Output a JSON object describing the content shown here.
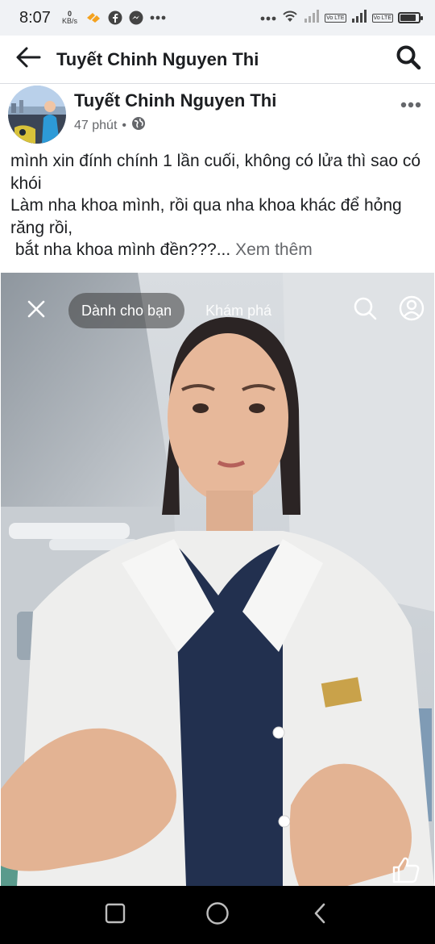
{
  "status_bar": {
    "time": "8:07",
    "net_speed_value": "0",
    "net_speed_unit": "KB/s",
    "lte_label_1": "Vo LTE",
    "lte_label_2": "Vo LTE",
    "battery_level": 0.85,
    "icons": [
      "mail-heart-icon",
      "facebook-icon",
      "messenger-icon",
      "more-dots-icon",
      "wifi-icon",
      "signal-icon",
      "battery-icon"
    ]
  },
  "header": {
    "title": "Tuyết Chinh Nguyen Thi"
  },
  "post": {
    "author": "Tuyết Chinh Nguyen Thi",
    "time_ago": "47 phút",
    "separator": "•",
    "audience_icon": "globe-icon",
    "text_lines": [
      "mình xin đính chính 1 lần cuối, không có lửa thì sao có khói",
      "Làm nha khoa mình, rồi qua nha khoa khác để hỏng răng rồi,",
      " bắt nha khoa mình đền???..."
    ],
    "see_more": "Xem thêm"
  },
  "video": {
    "for_you_label": "Dành cho bạn",
    "explore_label": "Khám phá",
    "icons": [
      "close-icon",
      "search-icon",
      "profile-icon",
      "thumbs-up-icon"
    ]
  },
  "colors": {
    "text_primary": "#1c1e21",
    "text_secondary": "#65676b",
    "status_bg": "#f0f2f5",
    "nav_bg": "#000000"
  }
}
